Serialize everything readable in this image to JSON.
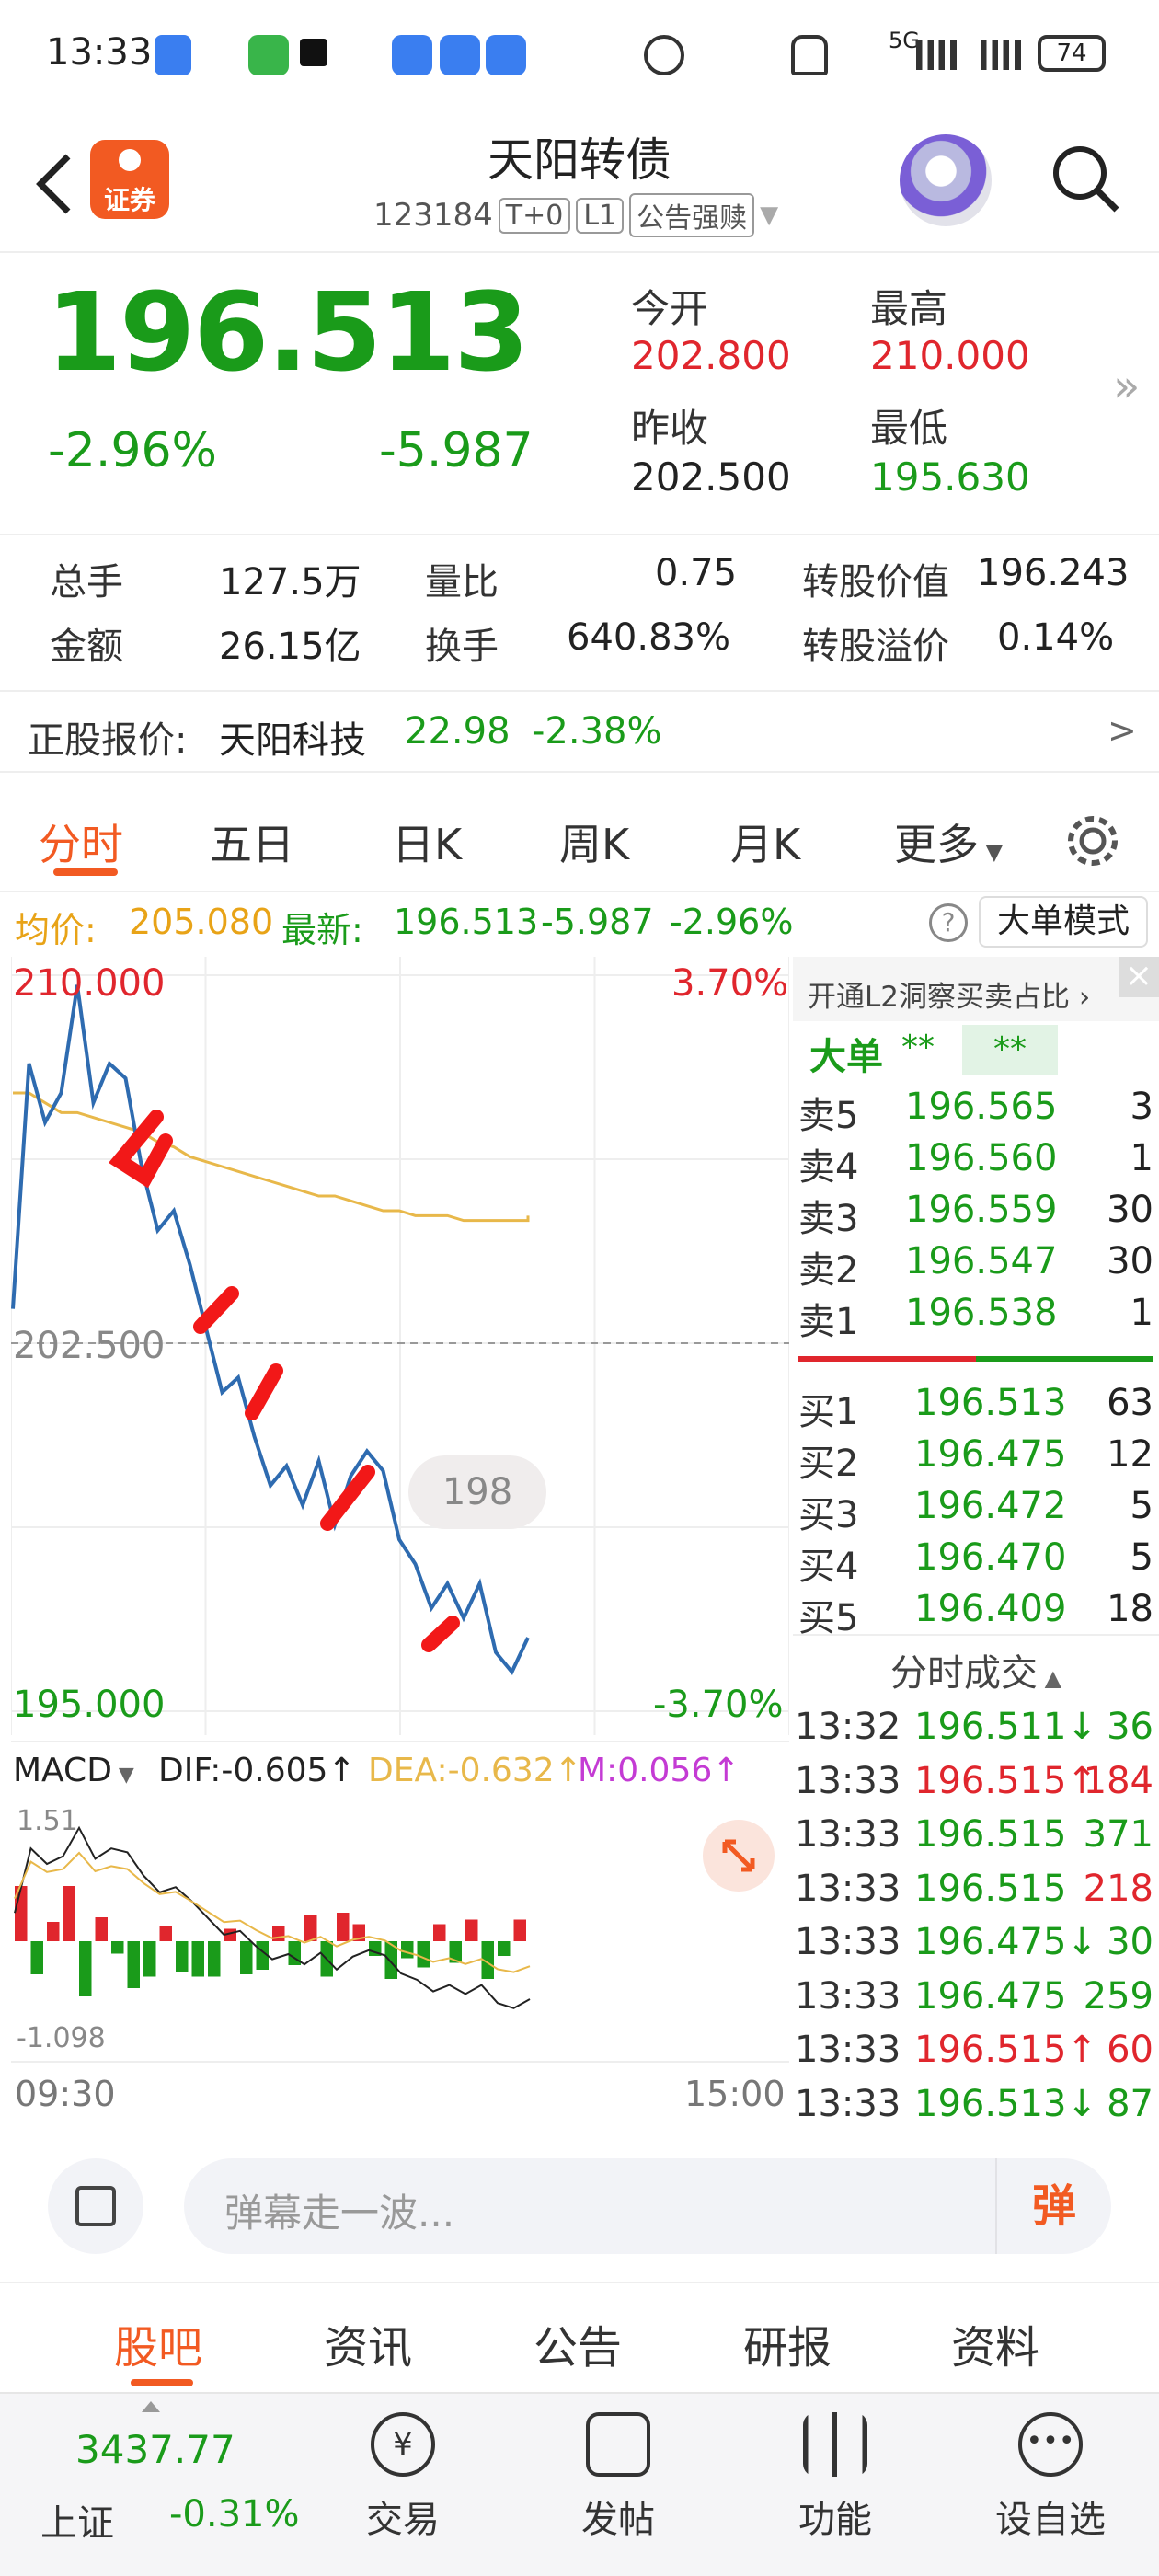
{
  "status_bar": {
    "time": "13:33",
    "signal_label": "5G",
    "battery": "74"
  },
  "header": {
    "title": "天阳转债",
    "code": "123184",
    "tag_t0": "T+0",
    "tag_l1": "L1",
    "tag_notice": "公告强赎",
    "logo_text": "证券"
  },
  "quote": {
    "price": "196.513",
    "change_pct": "-2.96%",
    "change": "-5.987",
    "open_label": "今开",
    "open": "202.800",
    "high_label": "最高",
    "high": "210.000",
    "prev_close_label": "昨收",
    "prev_close": "202.500",
    "low_label": "最低",
    "low": "195.630"
  },
  "stats": {
    "volume_label": "总手",
    "volume": "127.5万",
    "vol_ratio_label": "量比",
    "vol_ratio": "0.75",
    "conv_value_label": "转股价值",
    "conv_value": "196.243",
    "amount_label": "金额",
    "amount": "26.15亿",
    "turnover_label": "换手",
    "turnover": "640.83%",
    "premium_label": "转股溢价",
    "premium": "0.14%"
  },
  "underlying": {
    "label": "正股报价:",
    "name": "天阳科技",
    "price": "22.98",
    "change_pct": "-2.38%",
    "arrow": ">"
  },
  "tabs": [
    "分时",
    "五日",
    "日K",
    "周K",
    "月K",
    "更多"
  ],
  "avg_bar": {
    "avg_label": "均价:",
    "avg_value": "205.080",
    "latest_label": "最新:",
    "latest_value": "196.513",
    "latest_change": "-5.987",
    "latest_pct": "-2.96%",
    "help": "?",
    "mode_button": "大单模式"
  },
  "chart_labels": {
    "top_left": "210.000",
    "top_right": "3.70%",
    "mid_left": "202.500",
    "bottom_left": "195.000",
    "bottom_right": "-3.70%",
    "bubble": "198",
    "macd_select": "MACD",
    "dif": "DIF:-0.605↑",
    "dea": "DEA:-0.632↑",
    "m": "M:0.056↑",
    "macd_top": "1.51",
    "macd_bottom": "-1.098",
    "time_start": "09:30",
    "time_end": "15:00"
  },
  "chart_data": {
    "type": "line",
    "x": [
      "09:30",
      "09:35",
      "09:40",
      "09:45",
      "09:50",
      "09:55",
      "10:00",
      "10:05",
      "10:10",
      "10:15",
      "10:20",
      "10:25",
      "10:30",
      "10:35",
      "10:40",
      "10:45",
      "10:50",
      "10:55",
      "11:00",
      "11:05",
      "11:10",
      "11:15",
      "11:20",
      "11:25",
      "11:30",
      "13:00",
      "13:05",
      "13:10",
      "13:15",
      "13:20",
      "13:25",
      "13:30",
      "13:33"
    ],
    "series": [
      {
        "name": "price",
        "values": [
          203.2,
          208.2,
          207.0,
          207.6,
          209.8,
          207.4,
          208.2,
          207.9,
          206.1,
          204.8,
          205.2,
          204.1,
          202.8,
          201.5,
          201.8,
          200.6,
          199.6,
          200.0,
          199.2,
          200.1,
          198.8,
          199.8,
          200.3,
          199.9,
          198.5,
          198.0,
          197.1,
          197.6,
          196.9,
          197.6,
          196.2,
          195.8,
          196.5
        ]
      },
      {
        "name": "avg",
        "values": [
          207.6,
          207.6,
          207.4,
          207.2,
          207.2,
          207.1,
          207.0,
          206.9,
          206.8,
          206.6,
          206.5,
          206.3,
          206.2,
          206.1,
          206.0,
          205.9,
          205.8,
          205.7,
          205.6,
          205.5,
          205.5,
          205.4,
          205.3,
          205.2,
          205.2,
          205.1,
          205.1,
          205.1,
          205.0,
          205.0,
          205.0,
          205.0,
          205.1
        ]
      }
    ],
    "ylim": [
      195.0,
      210.0
    ],
    "prev_close": 202.5,
    "grid": true
  },
  "order_book": {
    "promo": "开通L2洞察买卖占比 ›",
    "big_label": "大单",
    "big_v1": "**",
    "big_v2": "**",
    "asks": [
      {
        "label": "卖5",
        "price": "196.565",
        "qty": "3"
      },
      {
        "label": "卖4",
        "price": "196.560",
        "qty": "1"
      },
      {
        "label": "卖3",
        "price": "196.559",
        "qty": "30"
      },
      {
        "label": "卖2",
        "price": "196.547",
        "qty": "30"
      },
      {
        "label": "卖1",
        "price": "196.538",
        "qty": "1"
      }
    ],
    "bids": [
      {
        "label": "买1",
        "price": "196.513",
        "qty": "63"
      },
      {
        "label": "买2",
        "price": "196.475",
        "qty": "12"
      },
      {
        "label": "买3",
        "price": "196.472",
        "qty": "5"
      },
      {
        "label": "买4",
        "price": "196.470",
        "qty": "5"
      },
      {
        "label": "买5",
        "price": "196.409",
        "qty": "18"
      }
    ],
    "trades_header": "分时成交",
    "trades": [
      {
        "time": "13:32",
        "price": "196.511↓",
        "qty": "36",
        "pc": "g",
        "qc": "g"
      },
      {
        "time": "13:33",
        "price": "196.515↑",
        "qty": "184",
        "pc": "r",
        "qc": "r"
      },
      {
        "time": "13:33",
        "price": "196.515",
        "qty": "371",
        "pc": "g",
        "qc": "g"
      },
      {
        "time": "13:33",
        "price": "196.515",
        "qty": "218",
        "pc": "g",
        "qc": "r"
      },
      {
        "time": "13:33",
        "price": "196.475↓",
        "qty": "30",
        "pc": "g",
        "qc": "g"
      },
      {
        "time": "13:33",
        "price": "196.475",
        "qty": "259",
        "pc": "g",
        "qc": "g"
      },
      {
        "time": "13:33",
        "price": "196.515↑",
        "qty": "60",
        "pc": "r",
        "qc": "r"
      },
      {
        "time": "13:33",
        "price": "196.513↓",
        "qty": "87",
        "pc": "g",
        "qc": "g"
      }
    ]
  },
  "danmu": {
    "placeholder": "弹幕走一波...",
    "send_label": "弹"
  },
  "bottom_tabs": [
    "股吧",
    "资讯",
    "公告",
    "研报",
    "资料"
  ],
  "toolbar": {
    "index_value": "3437.77",
    "index_name": "上证",
    "index_pct": "-0.31%",
    "trade": "交易",
    "post": "发帖",
    "func": "功能",
    "watch": "设自选"
  },
  "colors": {
    "up": "#e0262d",
    "down": "#1a9b1a",
    "accent": "#f25a22",
    "price_line": "#2e6bb0",
    "avg_line": "#e8b84a"
  }
}
